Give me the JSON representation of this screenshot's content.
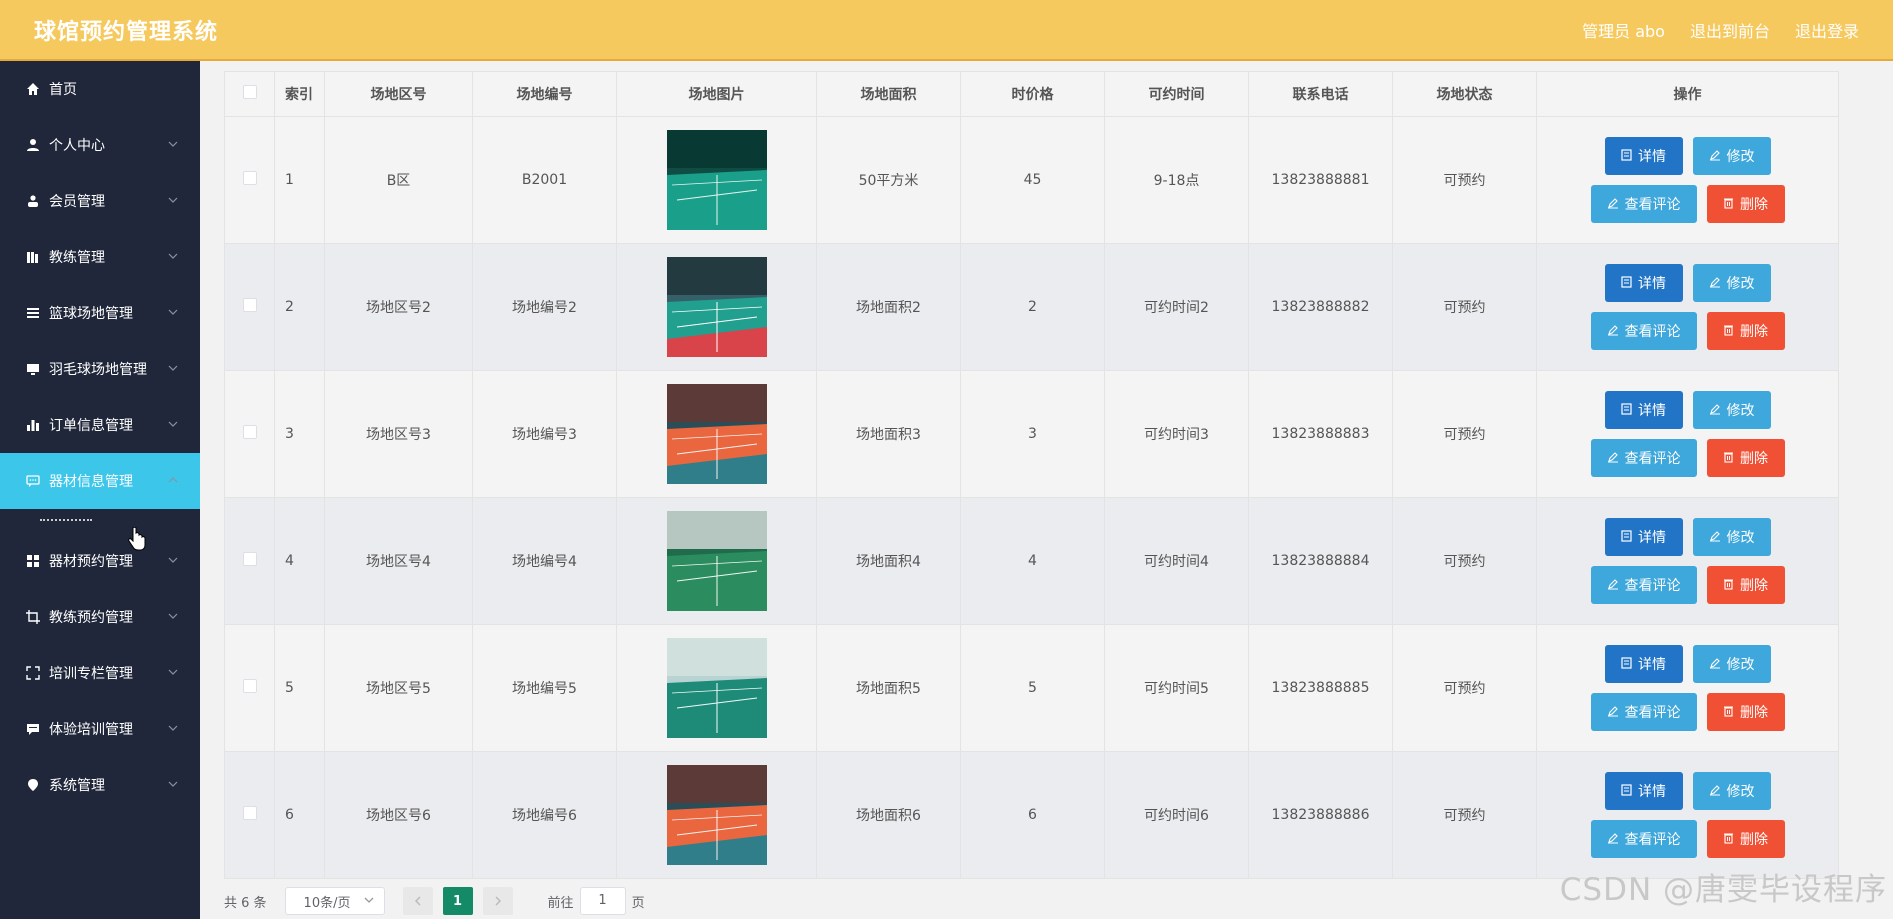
{
  "header": {
    "title": "球馆预约管理系统",
    "user": "管理员 abo",
    "back_front": "退出到前台",
    "logout": "退出登录"
  },
  "sidebar": {
    "items": [
      {
        "label": "首页",
        "icon": "home-icon",
        "has_arrow": false,
        "active": false
      },
      {
        "label": "个人中心",
        "icon": "user-icon",
        "has_arrow": true,
        "active": false
      },
      {
        "label": "会员管理",
        "icon": "member-icon",
        "has_arrow": true,
        "active": false
      },
      {
        "label": "教练管理",
        "icon": "library-icon",
        "has_arrow": true,
        "active": false
      },
      {
        "label": "篮球场地管理",
        "icon": "list-icon",
        "has_arrow": true,
        "active": false
      },
      {
        "label": "羽毛球场地管理",
        "icon": "monitor-icon",
        "has_arrow": true,
        "active": false
      },
      {
        "label": "订单信息管理",
        "icon": "bar-chart-icon",
        "has_arrow": true,
        "active": false
      },
      {
        "label": "器材信息管理",
        "icon": "chat-icon",
        "has_arrow": true,
        "active": true
      },
      {
        "label": "器材预约管理",
        "icon": "grid-icon",
        "has_arrow": true,
        "active": false
      },
      {
        "label": "教练预约管理",
        "icon": "crop-icon",
        "has_arrow": true,
        "active": false
      },
      {
        "label": "培训专栏管理",
        "icon": "fullscreen-icon",
        "has_arrow": true,
        "active": false
      },
      {
        "label": "体验培训管理",
        "icon": "message-icon",
        "has_arrow": true,
        "active": false
      },
      {
        "label": "系统管理",
        "icon": "location-icon",
        "has_arrow": true,
        "active": false
      }
    ]
  },
  "table": {
    "headers": [
      "索引",
      "场地区号",
      "场地编号",
      "场地图片",
      "场地面积",
      "时价格",
      "可约时间",
      "联系电话",
      "场地状态",
      "操作"
    ],
    "rows": [
      {
        "index": "1",
        "zone": "B区",
        "code": "B2001",
        "area": "50平方米",
        "price": "45",
        "time": "9-18点",
        "phone": "13823888881",
        "status": "可预约",
        "image": "badminton-court-blue"
      },
      {
        "index": "2",
        "zone": "场地区号2",
        "code": "场地编号2",
        "area": "场地面积2",
        "price": "2",
        "time": "可约时间2",
        "phone": "13823888882",
        "status": "可预约",
        "image": "badminton-court-red"
      },
      {
        "index": "3",
        "zone": "场地区号3",
        "code": "场地编号3",
        "area": "场地面积3",
        "price": "3",
        "time": "可约时间3",
        "phone": "13823888883",
        "status": "可预约",
        "image": "volleyball-court-orange"
      },
      {
        "index": "4",
        "zone": "场地区号4",
        "code": "场地编号4",
        "area": "场地面积4",
        "price": "4",
        "time": "可约时间4",
        "phone": "13823888884",
        "status": "可预约",
        "image": "badminton-court-green"
      },
      {
        "index": "5",
        "zone": "场地区号5",
        "code": "场地编号5",
        "area": "场地面积5",
        "price": "5",
        "time": "可约时间5",
        "phone": "13823888885",
        "status": "可预约",
        "image": "badminton-court-teal"
      },
      {
        "index": "6",
        "zone": "场地区号6",
        "code": "场地编号6",
        "area": "场地面积6",
        "price": "6",
        "time": "可约时间6",
        "phone": "13823888886",
        "status": "可预约",
        "image": "volleyball-court-orange"
      }
    ],
    "buttons": {
      "detail": "详情",
      "edit": "修改",
      "review": "查看评论",
      "delete": "删除"
    }
  },
  "pagination": {
    "total": "共 6 条",
    "page_size": "10条/页",
    "current_page": "1",
    "goto_label": "前往",
    "goto_value": "1",
    "page_unit": "页"
  },
  "watermark": "CSDN @唐雯毕设程序",
  "colors": {
    "header": "#f6c95f",
    "sidebar": "#20273a",
    "active_menu": "#3cc6ea",
    "detail_btn": "#2174c6",
    "edit_btn": "#3ea7dc",
    "delete_btn": "#f05034",
    "page_active": "#148a67"
  }
}
